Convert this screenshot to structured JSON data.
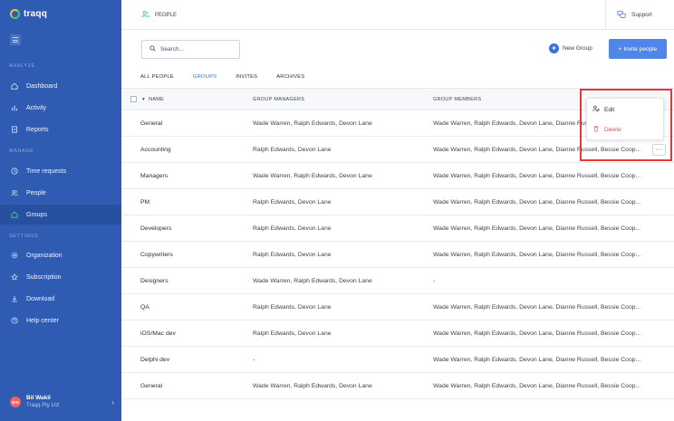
{
  "app": {
    "name": "traqq"
  },
  "sidebar": {
    "sections": [
      {
        "label": "ANALYZE"
      },
      {
        "label": "MANAGE"
      },
      {
        "label": "SETTINGS"
      }
    ],
    "items": [
      {
        "label": "Dashboard",
        "icon": "home-icon"
      },
      {
        "label": "Activity",
        "icon": "bar-chart-icon"
      },
      {
        "label": "Reports",
        "icon": "document-icon"
      },
      {
        "label": "Time requests",
        "icon": "clock-icon"
      },
      {
        "label": "People",
        "icon": "people-icon"
      },
      {
        "label": "Groups",
        "icon": "home-icon"
      },
      {
        "label": "Organization",
        "icon": "gear-icon"
      },
      {
        "label": "Subscription",
        "icon": "star-icon"
      },
      {
        "label": "Download",
        "icon": "download-icon"
      },
      {
        "label": "Help center",
        "icon": "help-icon"
      }
    ],
    "active_item": "Groups",
    "user": {
      "initials": "BW",
      "name": "Bil Wakil",
      "org": "Traqq Pty Ltd",
      "chevron": "›"
    }
  },
  "header": {
    "crumb": "PEOPLE",
    "support_label": "Support"
  },
  "toolbar": {
    "search_placeholder": "Search...",
    "new_group_label": "New Group",
    "new_group_icon": "+",
    "invite_label": "+ Invite people"
  },
  "tabs": [
    {
      "label": "ALL PEOPLE",
      "active": false
    },
    {
      "label": "GROUPS",
      "active": true
    },
    {
      "label": "INVITES",
      "active": false
    },
    {
      "label": "ARCHIVES",
      "active": false
    }
  ],
  "table": {
    "headers": {
      "name": "NAME",
      "sort_icon": "▾",
      "managers": "GROUP MANAGERS",
      "members": "GROUP MEMBERS"
    },
    "rows": [
      {
        "name": "General",
        "managers": "Wade Warren, Ralph Edwards, Devon Lane",
        "members": "Wade Warren, Ralph Edwards, Devon Lane, Dianne Russell, Bessie Coop..."
      },
      {
        "name": "Accounting",
        "managers": "Ralph Edwards, Devon Lane",
        "members": "Wade Warren, Ralph Edwards, Devon Lane, Dianne Russell, Bessie Coop..."
      },
      {
        "name": "Managers",
        "managers": "Wade Warren, Ralph Edwards, Devon Lane",
        "members": "Wade Warren, Ralph Edwards, Devon Lane, Dianne Russell, Bessie Coop..."
      },
      {
        "name": "PM",
        "managers": "Ralph Edwards, Devon Lane",
        "members": "Wade Warren, Ralph Edwards, Devon Lane, Dianne Russell, Bessie Coop..."
      },
      {
        "name": "Developers",
        "managers": "Ralph Edwards, Devon Lane",
        "members": "Wade Warren, Ralph Edwards, Devon Lane, Dianne Russell, Bessie Coop..."
      },
      {
        "name": "Copywriters",
        "managers": "Ralph Edwards, Devon Lane",
        "members": "Wade Warren, Ralph Edwards, Devon Lane, Dianne Russell, Bessie Coop..."
      },
      {
        "name": "Designers",
        "managers": "Wade Warren, Ralph Edwards, Devon Lane",
        "members": "-"
      },
      {
        "name": "QA",
        "managers": "Ralph Edwards, Devon Lane",
        "members": "Wade Warren, Ralph Edwards, Devon Lane, Dianne Russell, Bessie Coop..."
      },
      {
        "name": "iOS/Mac dev",
        "managers": "Ralph Edwards, Devon Lane",
        "members": "Wade Warren, Ralph Edwards, Devon Lane, Dianne Russell, Bessie Coop..."
      },
      {
        "name": "Delphi dev",
        "managers": "-",
        "members": "Wade Warren, Ralph Edwards, Devon Lane, Dianne Russell, Bessie Coop..."
      },
      {
        "name": "General",
        "managers": "Wade Warren, Ralph Edwards, Devon Lane",
        "members": "Wade Warren, Ralph Edwards, Devon Lane, Dianne Russell, Bessie Coop..."
      }
    ],
    "more_label": "···"
  },
  "context_menu": {
    "edit_label": "Edit",
    "delete_label": "Delete"
  },
  "colors": {
    "sidebar": "#2f5bb3",
    "accent": "#3b6fd8",
    "invite_button": "#4f86e8",
    "danger": "#e25555",
    "highlight": "#e53935"
  }
}
